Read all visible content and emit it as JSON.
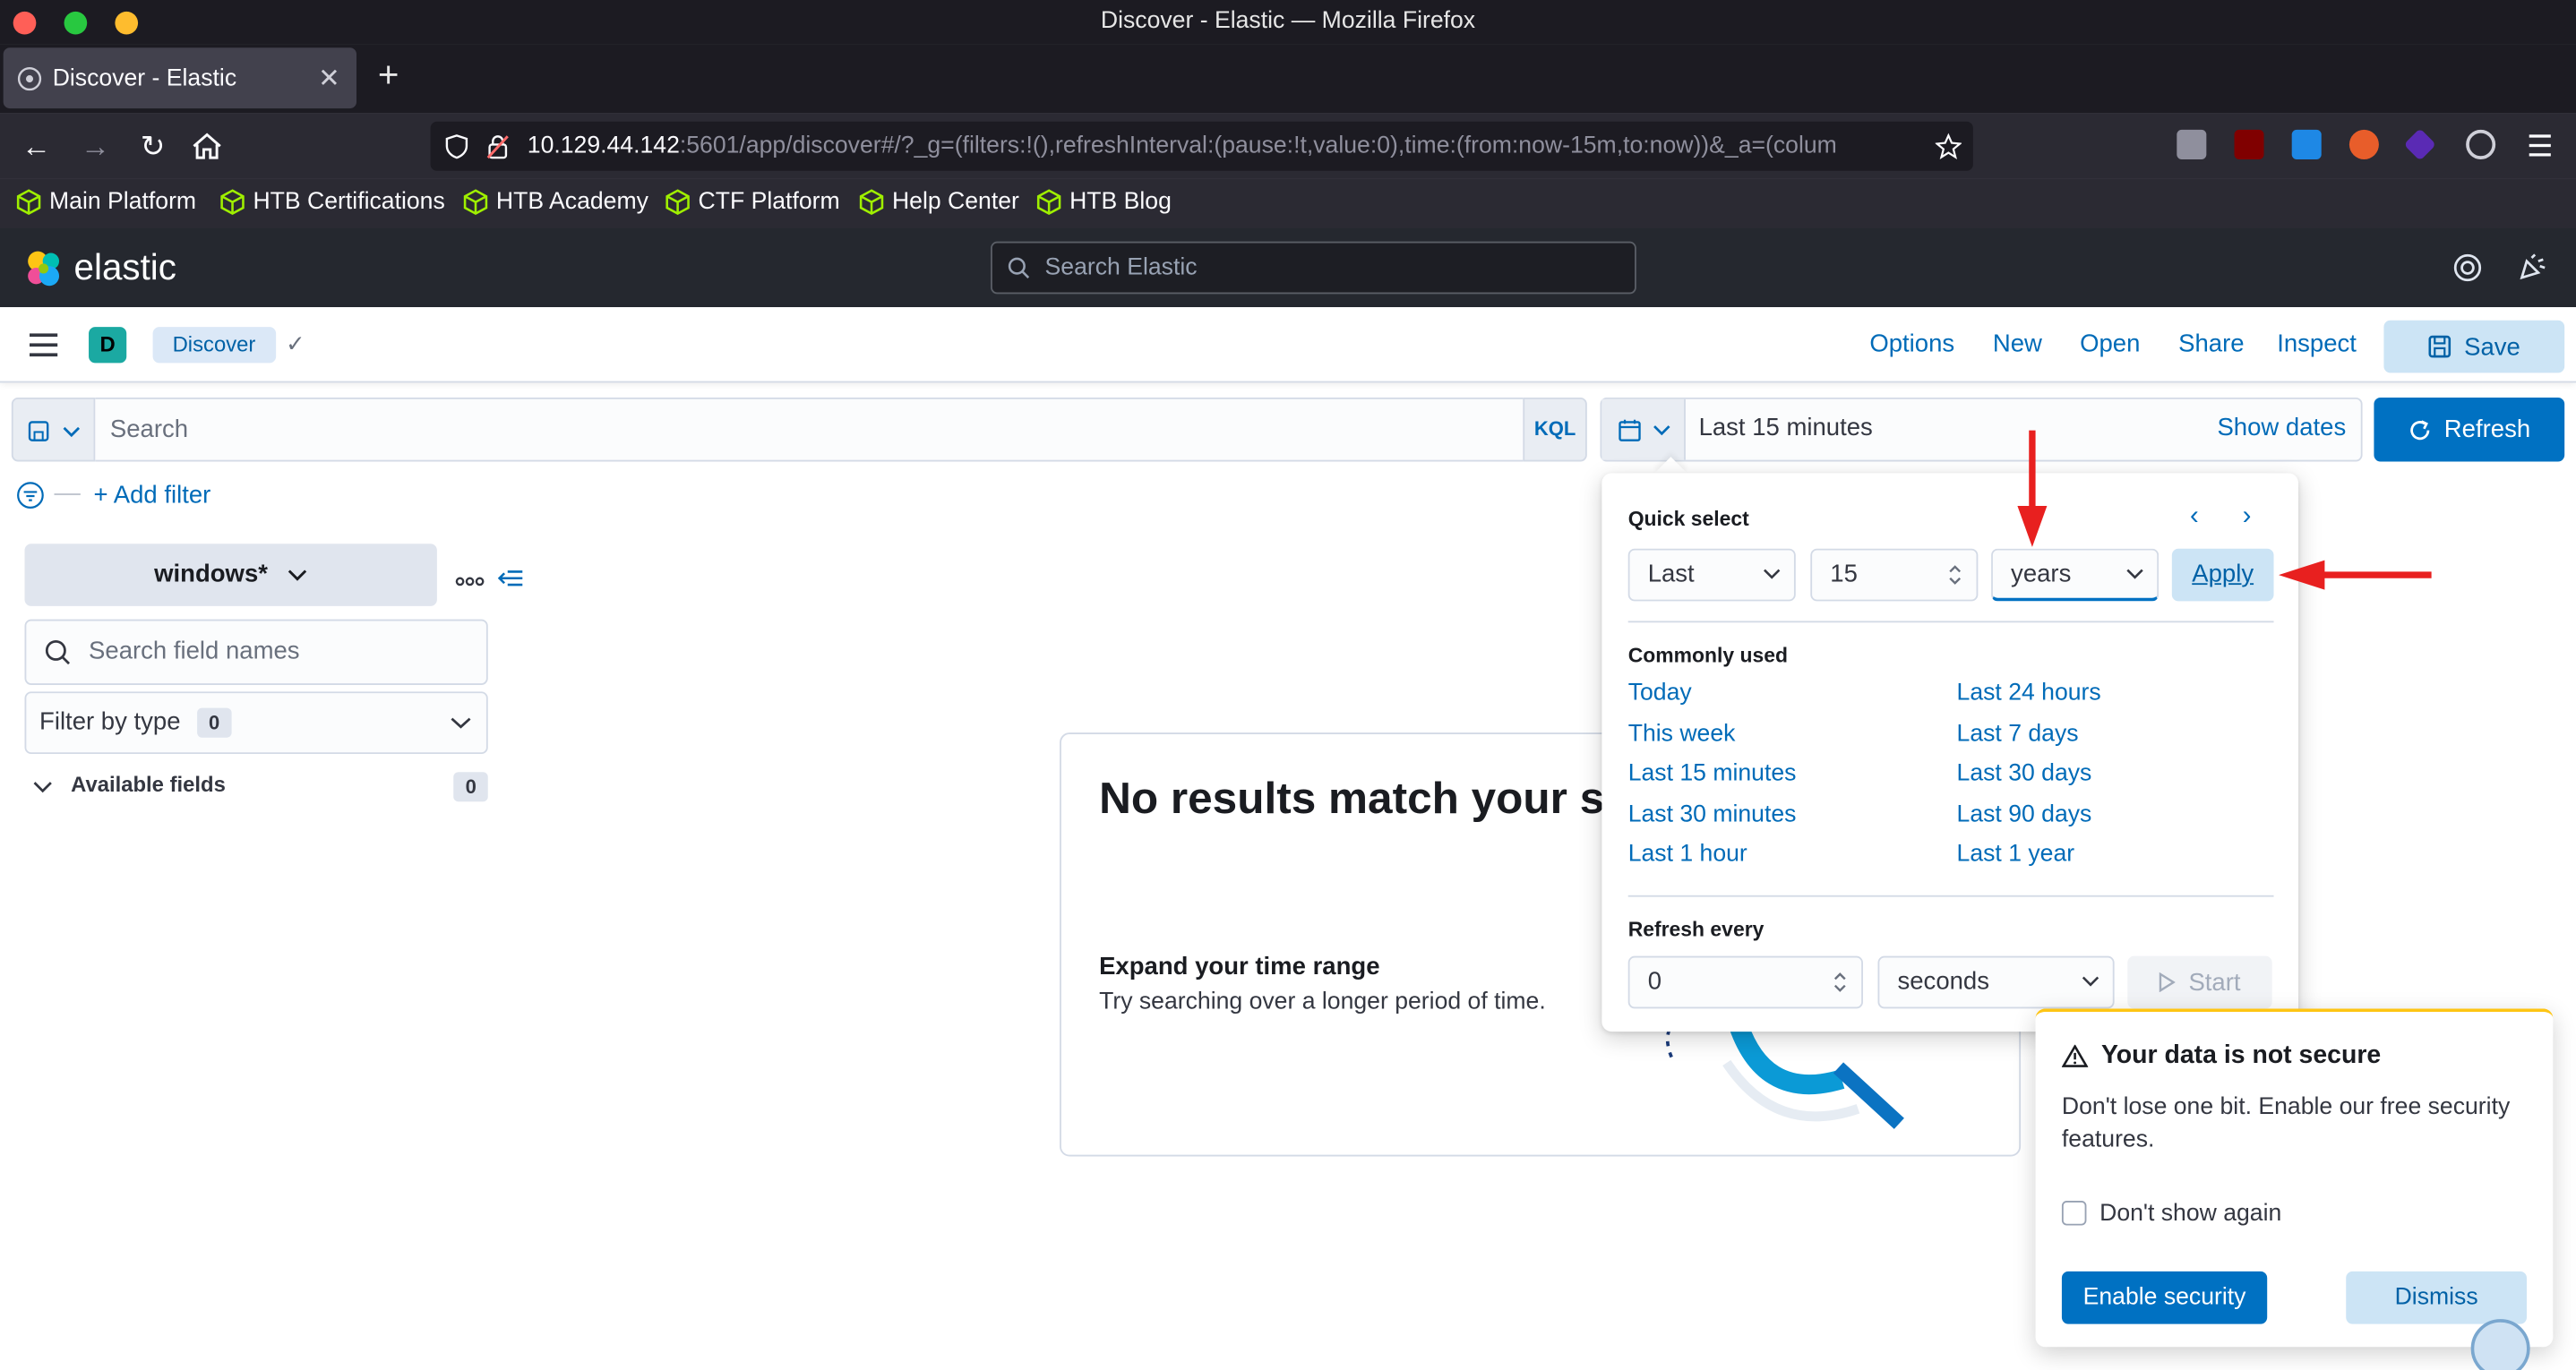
{
  "window": {
    "title": "Discover - Elastic — Mozilla Firefox"
  },
  "browser": {
    "tab_title": "Discover - Elastic",
    "url_host": "10.129.44.142",
    "url_rest": ":5601/app/discover#/?_g=(filters:!(),refreshInterval:(pause:!t,value:0),time:(from:now-15m,to:now))&_a=(colum",
    "bookmarks": [
      "Main Platform",
      "HTB Certifications",
      "HTB Academy",
      "CTF Platform",
      "Help Center",
      "HTB Blog"
    ]
  },
  "kibana": {
    "brand": "elastic",
    "search_placeholder": "Search Elastic",
    "space_initial": "D",
    "breadcrumb": "Discover",
    "top_menu": {
      "options": "Options",
      "new": "New",
      "open": "Open",
      "share": "Share",
      "inspect": "Inspect",
      "save": "Save"
    }
  },
  "query": {
    "placeholder": "Search",
    "language": "KQL",
    "time_range": "Last 15 minutes",
    "show_dates": "Show dates",
    "refresh": "Refresh",
    "add_filter": "+ Add filter"
  },
  "sidebar": {
    "index_pattern": "windows*",
    "field_search_placeholder": "Search field names",
    "filter_by_type": "Filter by type",
    "filter_count": "0",
    "available_fields": "Available fields",
    "available_count": "0"
  },
  "no_results": {
    "title": "No results match your s",
    "subtitle": "Expand your time range",
    "text": "Try searching over a longer period of time."
  },
  "quick_select": {
    "title": "Quick select",
    "direction": "Last",
    "amount": "15",
    "unit": "years",
    "apply": "Apply",
    "commonly_used_title": "Commonly used",
    "commonly_used_left": [
      "Today",
      "This week",
      "Last 15 minutes",
      "Last 30 minutes",
      "Last 1 hour"
    ],
    "commonly_used_right": [
      "Last 24 hours",
      "Last 7 days",
      "Last 30 days",
      "Last 90 days",
      "Last 1 year"
    ],
    "refresh_title": "Refresh every",
    "refresh_value": "0",
    "refresh_unit": "seconds",
    "start": "Start"
  },
  "toast": {
    "title": "Your data is not secure",
    "text": "Don't lose one bit. Enable our free security features.",
    "checkbox_label": "Don't show again",
    "enable": "Enable security",
    "dismiss": "Dismiss"
  },
  "colors": {
    "accent": "#0071c2",
    "link": "#006bb8",
    "annotation": "#e8201f"
  }
}
